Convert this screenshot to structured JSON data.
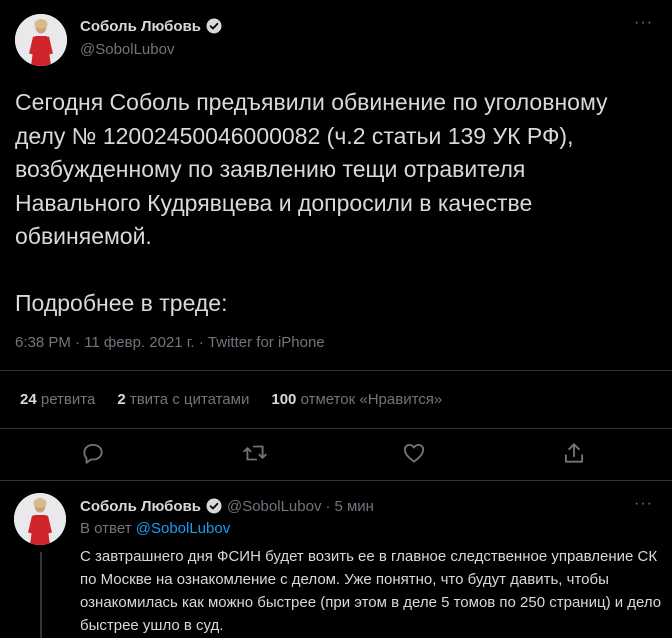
{
  "main_tweet": {
    "author_name": "Соболь Любовь",
    "author_handle": "@SobolLubov",
    "text": "Сегодня Соболь предъявили обвинение по уголовному делу № 12002450046000082 (ч.2 статьи 139 УК РФ), возбужденному по заявлению тещи отравителя Навального Кудрявцева и допросили в качестве обвиняемой.\n\nПодробнее в треде:",
    "meta": "6:38 PM · 11 февр. 2021 г. · Twitter for iPhone",
    "stats": [
      {
        "value": "24",
        "label": "ретвита"
      },
      {
        "value": "2",
        "label": "твита с цитатами"
      },
      {
        "value": "100",
        "label": "отметок «Нравится»"
      }
    ],
    "more_label": "···"
  },
  "reply_tweet": {
    "author_name": "Соболь Любовь",
    "author_handle": "@SobolLubov",
    "separator": "·",
    "time": "5 мин",
    "in_reply_prefix": "В ответ",
    "in_reply_handle": "@SobolLubov",
    "text": "С завтрашнего дня ФСИН будет возить ее в главное следственное управление СК по Москве на ознакомление с делом. Уже понятно, что будут давить, чтобы ознакомилась как можно быстрее (при этом в деле 5 томов по 250 страниц) и дело быстрее ушло в суд.",
    "more_label": "···"
  },
  "icons": {
    "reply": "reply-icon",
    "retweet": "retweet-icon",
    "like": "heart-icon",
    "share": "share-icon",
    "verified": "verified-badge-icon"
  },
  "colors": {
    "background": "#000000",
    "text": "#d9d9d9",
    "muted": "#6e767d",
    "link": "#1d9bf0",
    "avatar_dress": "#d0242b"
  }
}
